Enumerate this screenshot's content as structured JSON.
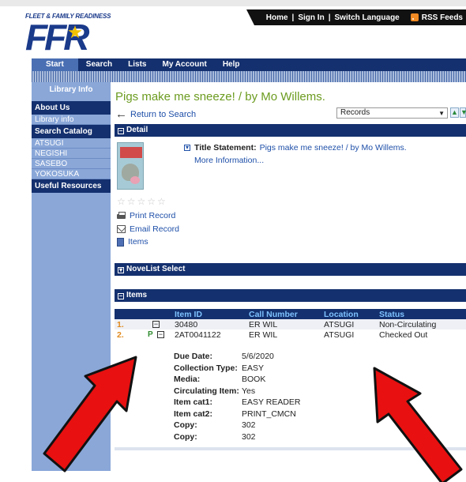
{
  "top_links": {
    "home": "Home",
    "sign_in": "Sign In",
    "switch_language": "Switch Language",
    "rss": "RSS Feeds",
    "sep": "|"
  },
  "logo": {
    "tagline": "FLEET & FAMILY READINESS",
    "letters": "FFR"
  },
  "nav": {
    "start": "Start",
    "search": "Search",
    "lists": "Lists",
    "my_account": "My Account",
    "help": "Help"
  },
  "sidebar": {
    "library_info_title": "Library Info",
    "about_us": "About Us",
    "library_info_link": "Library info",
    "search_catalog": "Search Catalog",
    "locations": [
      "ATSUGI",
      "NEGISHI",
      "SASEBO",
      "YOKOSUKA"
    ],
    "useful_resources": "Useful Resources"
  },
  "record": {
    "title": "Pigs make me sneeze! / by Mo Willems.",
    "return_link": "Return to Search",
    "records_select": "Records",
    "detail_label": "Detail",
    "title_statement_label": "Title Statement:",
    "title_statement_value": "Pigs make me sneeze! / by Mo Willems.",
    "more_information": "More Information...",
    "cover_text": "Pigs Make Me Sneeze!",
    "stars": "☆☆☆☆☆",
    "print_record": "Print Record",
    "email_record": "Email Record",
    "items_link": "Items",
    "novelist_label": "NoveList Select",
    "items_label": "Items"
  },
  "items_table": {
    "headers": [
      "Item ID",
      "Call Number",
      "Location",
      "Status"
    ],
    "rows": [
      {
        "num": "1.",
        "item_id": "30480",
        "call_number": "ER WIL",
        "location": "ATSUGI",
        "status": "Non-Circulating"
      },
      {
        "num": "2.",
        "item_id": "2AT0041122",
        "call_number": "ER WIL",
        "location": "ATSUGI",
        "status": "Checked Out"
      }
    ]
  },
  "item_details": [
    {
      "label": "Due Date:",
      "value": "5/6/2020"
    },
    {
      "label": "Collection Type:",
      "value": "EASY"
    },
    {
      "label": "Media:",
      "value": "BOOK"
    },
    {
      "label": "Circulating Item:",
      "value": "Yes"
    },
    {
      "label": "Item cat1:",
      "value": "EASY READER"
    },
    {
      "label": "Item cat2:",
      "value": "PRINT_CMCN"
    },
    {
      "label": "Copy:",
      "value": "302"
    },
    {
      "label": "Copy:",
      "value": "302"
    }
  ],
  "colors": {
    "navy": "#14306e",
    "sidebar_blue": "#8aa7d8",
    "title_green": "#6b9b1f",
    "link_blue": "#1e4fa8",
    "arrow_red": "#e81010"
  }
}
